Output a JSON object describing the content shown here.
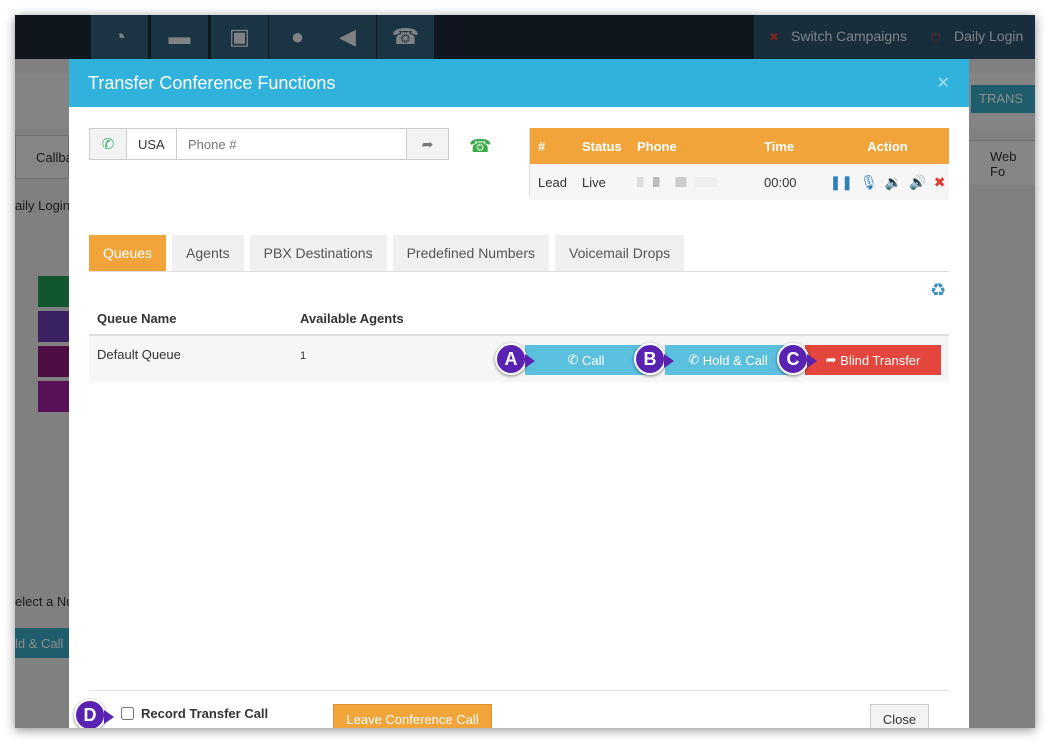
{
  "topbar": {
    "switch_campaigns": "Switch Campaigns",
    "daily_login": "Daily Login",
    "nav_icons": [
      "dashboard-icon",
      "folder-icon",
      "briefcase-icon",
      "lightbulb-icon",
      "megaphone-icon",
      "phone-square-icon"
    ]
  },
  "background": {
    "callback_label": "Callba",
    "daily_login_label": "aily Login",
    "select_label": "elect a Nu",
    "hold_call_label": "ld & Call",
    "web_form_label": "Web Fo",
    "transfer_button": "TRANS",
    "swatch_colors": [
      "#1f9d55",
      "#6a3fb5",
      "#8e1b7d",
      "#a01ea0"
    ]
  },
  "modal": {
    "title": "Transfer Conference Functions",
    "phone": {
      "country": "USA",
      "placeholder": "Phone #"
    },
    "call_table": {
      "headers": [
        "#",
        "Status",
        "Phone",
        "Time",
        "Action"
      ],
      "row": {
        "number": "Lead",
        "status": "Live",
        "time": "00:00"
      }
    },
    "tabs": [
      "Queues",
      "Agents",
      "PBX Destinations",
      "Predefined Numbers",
      "Voicemail Drops"
    ],
    "queue_table": {
      "headers": [
        "Queue Name",
        "Available Agents"
      ],
      "rows": [
        {
          "name": "Default Queue",
          "agents": "1"
        }
      ]
    },
    "buttons": {
      "call": "Call",
      "hold_call": "Hold & Call",
      "blind_transfer": "Blind Transfer",
      "leave_conference": "Leave Conference Call",
      "close": "Close"
    },
    "record_transfer_label": "Record Transfer Call",
    "markers": [
      "A",
      "B",
      "C",
      "D"
    ],
    "accent_color": "#31b2dd",
    "orange_color": "#f0a43a"
  }
}
